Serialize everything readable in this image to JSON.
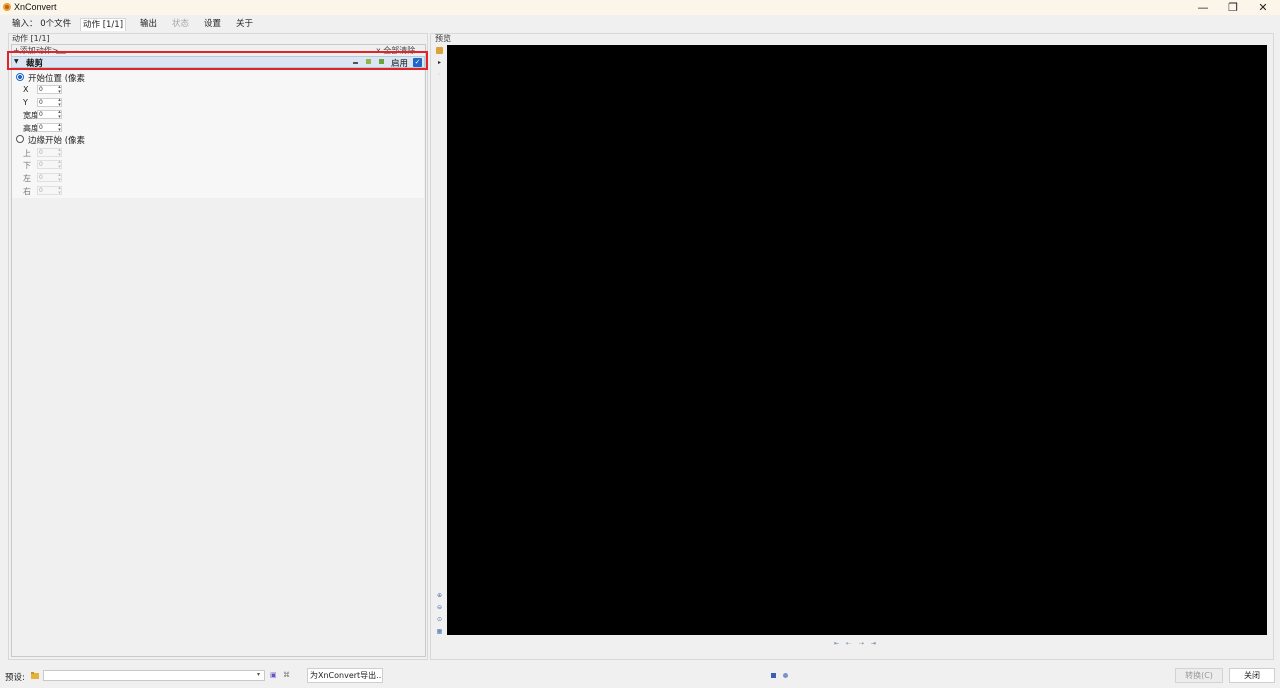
{
  "window": {
    "title": "XnConvert",
    "controls": {
      "minimize": "—",
      "restore": "❐",
      "close": "✕"
    }
  },
  "tabs": [
    {
      "label": "输入：  0个文件"
    },
    {
      "label": "动作 [1/1]",
      "active": true
    },
    {
      "label": "输出"
    },
    {
      "label": "状态",
      "disabled": true
    },
    {
      "label": "设置"
    },
    {
      "label": "关于"
    }
  ],
  "actions_panel": {
    "caption": "动作 [1/1]",
    "add_action": "+添加动作>",
    "clear_all": "x 全部清除",
    "action": {
      "name": "裁剪",
      "enable_label": "启用",
      "enabled": true,
      "chevron": "▼"
    },
    "start_position": {
      "label": "开始位置  (像素",
      "selected": true,
      "fields": [
        {
          "label": "X",
          "value": "0"
        },
        {
          "label": "Y",
          "value": "0"
        },
        {
          "label": "宽度",
          "value": "0"
        },
        {
          "label": "高度",
          "value": "0"
        }
      ]
    },
    "from_edges": {
      "label": "边缘开始  (像素",
      "selected": false,
      "fields": [
        {
          "label": "上",
          "value": "0"
        },
        {
          "label": "下",
          "value": "0"
        },
        {
          "label": "左",
          "value": "0"
        },
        {
          "label": "右",
          "value": "0"
        }
      ]
    }
  },
  "preview_panel": {
    "label": "预览",
    "nav": [
      "⇤",
      "⇠",
      "⇢",
      "⇥"
    ]
  },
  "bottom_bar": {
    "preset_label": "预设:",
    "preset_value": "",
    "export_button": "为XnConvert导出...",
    "convert_button": "转换(C)",
    "close_button": "关闭"
  },
  "colors": {
    "highlight": "#e0242a",
    "accent": "#1e67c7",
    "preview_bg": "#000000"
  }
}
